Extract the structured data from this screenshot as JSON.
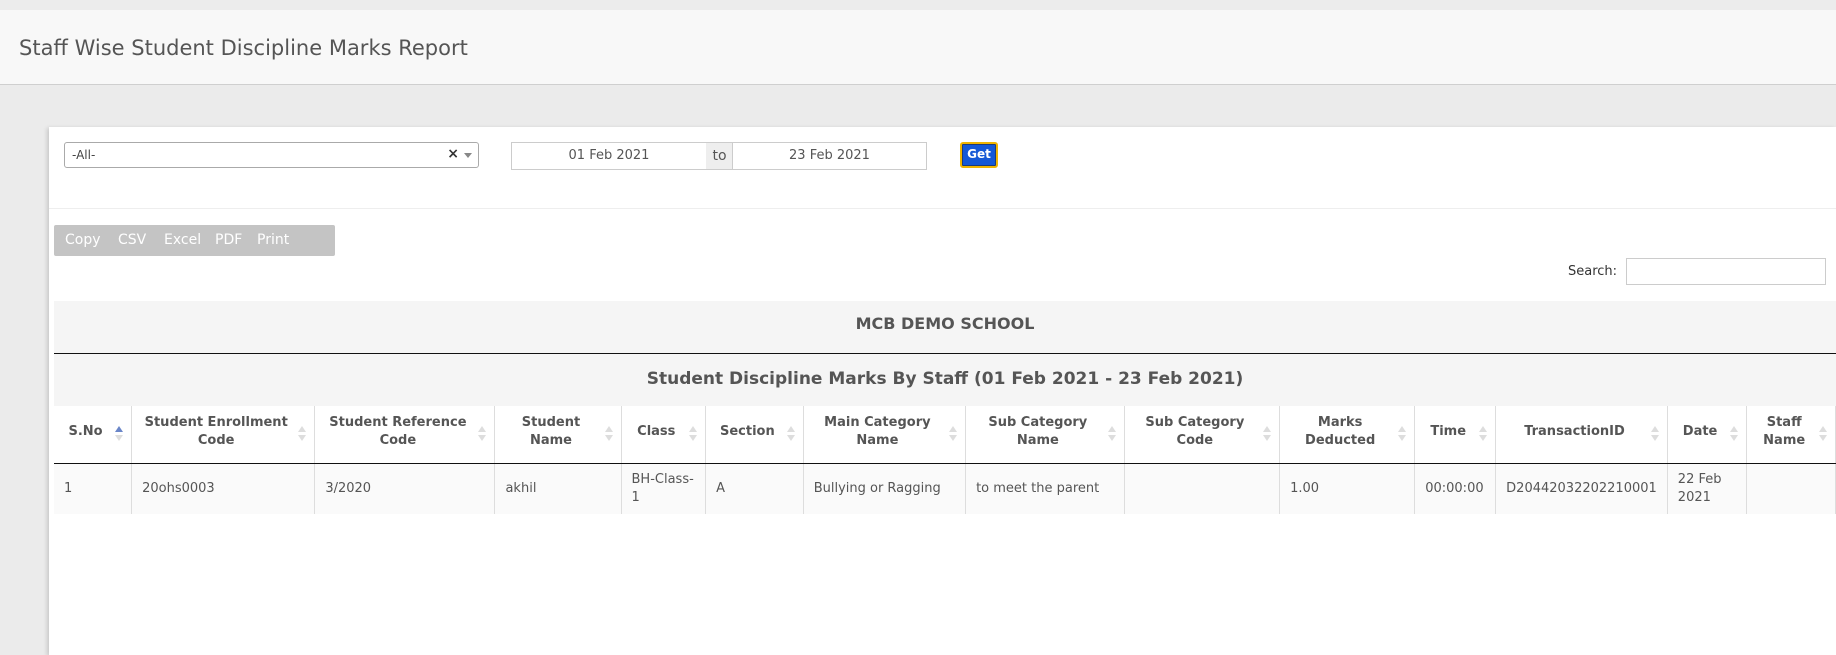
{
  "header": {
    "title": "Staff Wise Student Discipline Marks Report"
  },
  "filters": {
    "staff_select_value": "-All-",
    "clear_symbol": "×",
    "date_from": "01 Feb 2021",
    "date_separator": "to",
    "date_to": "23 Feb 2021",
    "get_label": "Get"
  },
  "export_buttons": [
    "Copy",
    "CSV",
    "Excel",
    "PDF",
    "Print"
  ],
  "search": {
    "label": "Search:",
    "value": ""
  },
  "report": {
    "school_name": "MCB DEMO SCHOOL",
    "title": "Student Discipline Marks By Staff (01 Feb 2021 - 23 Feb 2021)"
  },
  "table": {
    "columns": [
      "S.No",
      "Student Enrollment Code",
      "Student Reference Code",
      "Student Name",
      "Class",
      "Section",
      "Main Category Name",
      "Sub Category Name",
      "Sub Category Code",
      "Marks Deducted",
      "Time",
      "TransactionID",
      "Date",
      "Staff Name"
    ],
    "rows": [
      [
        "1",
        "20ohs0003",
        "3/2020",
        "akhil",
        "BH-Class-1",
        "A",
        "Bullying or Ragging",
        "to meet the parent",
        "",
        "1.00",
        "00:00:00",
        "D20442032202210001",
        "22 Feb 2021",
        ""
      ]
    ]
  },
  "colors": {
    "accent": "#1558d6",
    "focus_outline": "#f0b400",
    "export_bg": "#c4c4c4"
  }
}
